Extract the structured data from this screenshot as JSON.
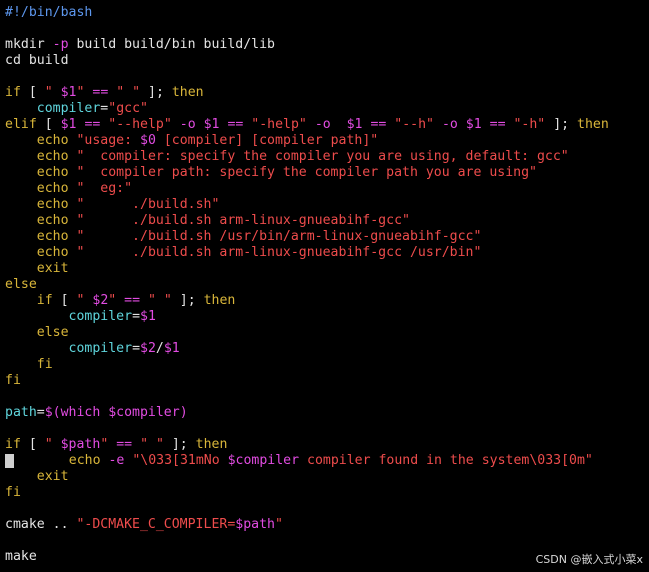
{
  "editor": {
    "lines": [
      [
        [
          "c",
          "#!/bin/bash"
        ]
      ],
      [],
      [
        [
          "d",
          "mkdir "
        ],
        [
          "o",
          "-p"
        ],
        [
          "d",
          " build build/bin build/lib"
        ]
      ],
      [
        [
          "d",
          "cd build"
        ]
      ],
      [],
      [
        [
          "k",
          "if"
        ],
        [
          "d",
          " [ "
        ],
        [
          "s",
          "\" "
        ],
        [
          "v",
          "$1"
        ],
        [
          "s",
          "\""
        ],
        [
          "d",
          " "
        ],
        [
          "o",
          "=="
        ],
        [
          "d",
          " "
        ],
        [
          "s",
          "\" \""
        ],
        [
          "d",
          " ]; "
        ],
        [
          "k",
          "then"
        ]
      ],
      [
        [
          "d",
          "    "
        ],
        [
          "i",
          "compiler"
        ],
        [
          "d",
          "="
        ],
        [
          "s",
          "\"gcc\""
        ]
      ],
      [
        [
          "k",
          "elif"
        ],
        [
          "d",
          " [ "
        ],
        [
          "v",
          "$1"
        ],
        [
          "d",
          " "
        ],
        [
          "o",
          "=="
        ],
        [
          "d",
          " "
        ],
        [
          "s",
          "\"--help\""
        ],
        [
          "d",
          " "
        ],
        [
          "o",
          "-o"
        ],
        [
          "d",
          " "
        ],
        [
          "v",
          "$1"
        ],
        [
          "d",
          " "
        ],
        [
          "o",
          "=="
        ],
        [
          "d",
          " "
        ],
        [
          "s",
          "\"-help\""
        ],
        [
          "d",
          " "
        ],
        [
          "o",
          "-o"
        ],
        [
          "d",
          "  "
        ],
        [
          "v",
          "$1"
        ],
        [
          "d",
          " "
        ],
        [
          "o",
          "=="
        ],
        [
          "d",
          " "
        ],
        [
          "s",
          "\"--h\""
        ],
        [
          "d",
          " "
        ],
        [
          "o",
          "-o"
        ],
        [
          "d",
          " "
        ],
        [
          "v",
          "$1"
        ],
        [
          "d",
          " "
        ],
        [
          "o",
          "=="
        ],
        [
          "d",
          " "
        ],
        [
          "s",
          "\"-h\""
        ],
        [
          "d",
          " ]; "
        ],
        [
          "k",
          "then"
        ]
      ],
      [
        [
          "d",
          "    "
        ],
        [
          "k",
          "echo"
        ],
        [
          "d",
          " "
        ],
        [
          "s",
          "\"usage: "
        ],
        [
          "v",
          "$0"
        ],
        [
          "s",
          " [compiler] [compiler path]\""
        ]
      ],
      [
        [
          "d",
          "    "
        ],
        [
          "k",
          "echo"
        ],
        [
          "d",
          " "
        ],
        [
          "s",
          "\"  compiler: specify the compiler you are using, default: gcc\""
        ]
      ],
      [
        [
          "d",
          "    "
        ],
        [
          "k",
          "echo"
        ],
        [
          "d",
          " "
        ],
        [
          "s",
          "\"  compiler path: specify the compiler path you are using\""
        ]
      ],
      [
        [
          "d",
          "    "
        ],
        [
          "k",
          "echo"
        ],
        [
          "d",
          " "
        ],
        [
          "s",
          "\"  eg:\""
        ]
      ],
      [
        [
          "d",
          "    "
        ],
        [
          "k",
          "echo"
        ],
        [
          "d",
          " "
        ],
        [
          "s",
          "\"      ./build.sh\""
        ]
      ],
      [
        [
          "d",
          "    "
        ],
        [
          "k",
          "echo"
        ],
        [
          "d",
          " "
        ],
        [
          "s",
          "\"      ./build.sh arm-linux-gnueabihf-gcc\""
        ]
      ],
      [
        [
          "d",
          "    "
        ],
        [
          "k",
          "echo"
        ],
        [
          "d",
          " "
        ],
        [
          "s",
          "\"      ./build.sh /usr/bin/arm-linux-gnueabihf-gcc\""
        ]
      ],
      [
        [
          "d",
          "    "
        ],
        [
          "k",
          "echo"
        ],
        [
          "d",
          " "
        ],
        [
          "s",
          "\"      ./build.sh arm-linux-gnueabihf-gcc /usr/bin\""
        ]
      ],
      [
        [
          "d",
          "    "
        ],
        [
          "k",
          "exit"
        ]
      ],
      [
        [
          "k",
          "else"
        ]
      ],
      [
        [
          "d",
          "    "
        ],
        [
          "k",
          "if"
        ],
        [
          "d",
          " [ "
        ],
        [
          "s",
          "\" "
        ],
        [
          "v",
          "$2"
        ],
        [
          "s",
          "\""
        ],
        [
          "d",
          " "
        ],
        [
          "o",
          "=="
        ],
        [
          "d",
          " "
        ],
        [
          "s",
          "\" \""
        ],
        [
          "d",
          " ]; "
        ],
        [
          "k",
          "then"
        ]
      ],
      [
        [
          "d",
          "        "
        ],
        [
          "i",
          "compiler"
        ],
        [
          "d",
          "="
        ],
        [
          "v",
          "$1"
        ]
      ],
      [
        [
          "d",
          "    "
        ],
        [
          "k",
          "else"
        ]
      ],
      [
        [
          "d",
          "        "
        ],
        [
          "i",
          "compiler"
        ],
        [
          "d",
          "="
        ],
        [
          "v",
          "$2"
        ],
        [
          "d",
          "/"
        ],
        [
          "v",
          "$1"
        ]
      ],
      [
        [
          "d",
          "    "
        ],
        [
          "k",
          "fi"
        ]
      ],
      [
        [
          "k",
          "fi"
        ]
      ],
      [],
      [
        [
          "i",
          "path"
        ],
        [
          "d",
          "="
        ],
        [
          "v",
          "$(which $compiler)"
        ]
      ],
      [],
      [
        [
          "k",
          "if"
        ],
        [
          "d",
          " [ "
        ],
        [
          "s",
          "\" "
        ],
        [
          "v",
          "$path"
        ],
        [
          "s",
          "\""
        ],
        [
          "d",
          " "
        ],
        [
          "o",
          "=="
        ],
        [
          "d",
          " "
        ],
        [
          "s",
          "\" \""
        ],
        [
          "d",
          " ]; "
        ],
        [
          "k",
          "then"
        ]
      ],
      [
        [
          "d",
          "    "
        ],
        [
          "k",
          "echo"
        ],
        [
          "d",
          " "
        ],
        [
          "o",
          "-e"
        ],
        [
          "d",
          " "
        ],
        [
          "s",
          "\"\\033[31mNo "
        ],
        [
          "v",
          "$compiler"
        ],
        [
          "s",
          " compiler found in the system\\033[0m\""
        ]
      ],
      [
        [
          "d",
          "    "
        ],
        [
          "k",
          "exit"
        ]
      ],
      [
        [
          "k",
          "fi"
        ]
      ],
      [],
      [
        [
          "d",
          "cmake .. "
        ],
        [
          "s",
          "\"-DCMAKE_C_COMPILER="
        ],
        [
          "v",
          "$path"
        ],
        [
          "s",
          "\""
        ]
      ],
      [],
      [
        [
          "d",
          "make"
        ]
      ]
    ],
    "cursor_line": 29
  },
  "watermark": "CSDN @嵌入式小菜x"
}
